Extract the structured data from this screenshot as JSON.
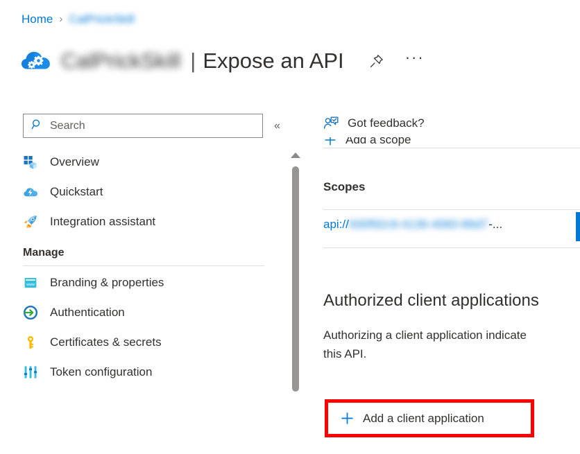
{
  "breadcrumb": {
    "home_label": "Home",
    "separator": "›",
    "current_label": "CalPrickSkill"
  },
  "header": {
    "app_name": "CalPrickSkill",
    "divider": "|",
    "page_title": "Expose an API",
    "pin_icon": "pin-icon",
    "more_label": "···",
    "app_icon": "cloud-gears-icon"
  },
  "sidebar": {
    "search": {
      "placeholder": "Search",
      "value": "",
      "icon": "search-icon"
    },
    "collapse_label": "«",
    "items": [
      {
        "label": "Overview",
        "icon": "overview-grid-icon"
      },
      {
        "label": "Quickstart",
        "icon": "quickstart-cloud-icon"
      },
      {
        "label": "Integration assistant",
        "icon": "rocket-icon"
      }
    ],
    "group": {
      "title": "Manage",
      "items": [
        {
          "label": "Branding & properties",
          "icon": "www-browser-icon"
        },
        {
          "label": "Authentication",
          "icon": "authentication-arrow-icon"
        },
        {
          "label": "Certificates & secrets",
          "icon": "key-icon"
        },
        {
          "label": "Token configuration",
          "icon": "sliders-icon"
        }
      ]
    },
    "scrollbar": {
      "up_arrow": "scroll-up-arrow-icon"
    }
  },
  "content": {
    "command_bar": {
      "feedback_label": "Got feedback?",
      "feedback_icon": "feedback-person-icon"
    },
    "add_scope": {
      "label": "Add a scope",
      "icon": "plus-icon"
    },
    "scopes": {
      "heading": "Scopes",
      "value_prefix": "api://",
      "value_redacted": "930f92c9-4136-4060-86d7",
      "value_suffix": "-..."
    },
    "authorized": {
      "heading": "Authorized client applications",
      "description": "Authorizing a client application indicate\nthis API.",
      "add_client": {
        "label": "Add a client application",
        "icon": "plus-icon"
      }
    }
  },
  "colors": {
    "accent": "#0078d4",
    "highlight": "#ff0000",
    "text": "#323130",
    "rule": "#e1dfdd"
  }
}
